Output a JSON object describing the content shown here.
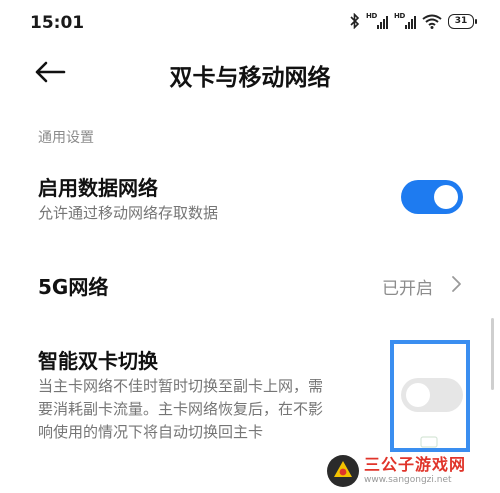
{
  "status_bar": {
    "time": "15:01",
    "signal_1_label": "HD",
    "signal_2_label": "HD",
    "battery": "31",
    "icons": [
      "bluetooth-icon",
      "signal-icon",
      "signal-icon",
      "wifi-icon",
      "battery-icon"
    ]
  },
  "header": {
    "title": "双卡与移动网络",
    "back_icon": "back-arrow-icon"
  },
  "section": {
    "label": "通用设置"
  },
  "settings": {
    "data_network": {
      "title": "启用数据网络",
      "subtitle": "允许通过移动网络存取数据",
      "enabled": true
    },
    "five_g": {
      "title": "5G网络",
      "value": "已开启"
    },
    "smart_dual": {
      "title": "智能双卡切换",
      "subtitle_line1": "当主卡网络不佳时暂时切换至副卡上网，需",
      "subtitle_line2": "要消耗副卡流量。主卡网络恢复后，在不影",
      "subtitle_line3": "响使用的情况下将自动切换回主卡",
      "enabled": false
    }
  },
  "colors": {
    "accent": "#1e7bf0",
    "highlight_border": "#3a8ef0",
    "secondary_text": "#8c8c8c",
    "watermark_red": "#e0342a"
  },
  "watermark": {
    "name": "三公子游戏网",
    "url": "www.sangongzi.net"
  }
}
